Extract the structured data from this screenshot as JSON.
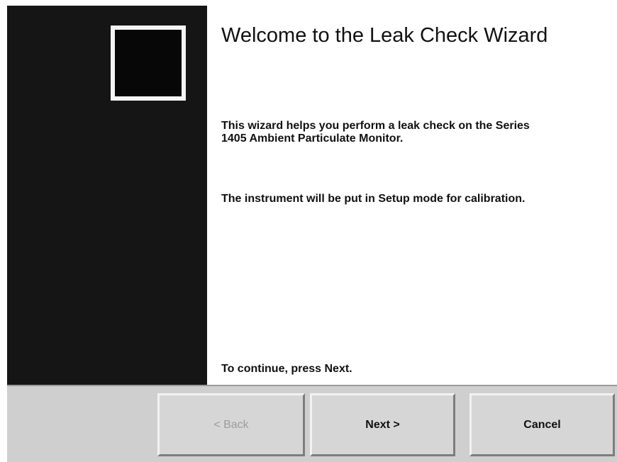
{
  "wizard": {
    "title": "Welcome to the Leak Check Wizard",
    "paragraph_1": "This wizard helps you perform a leak check on the Series 1405 Ambient Particulate Monitor.",
    "paragraph_2": "The instrument will be put in Setup mode for calibration.",
    "continue_text": "To continue, press Next."
  },
  "buttons": {
    "back_label": "< Back",
    "next_label": "Next >",
    "cancel_label": "Cancel"
  },
  "colors": {
    "side_panel": "#151515",
    "button_bar": "#cfcfcf",
    "disabled_text": "#9c9c9c"
  }
}
